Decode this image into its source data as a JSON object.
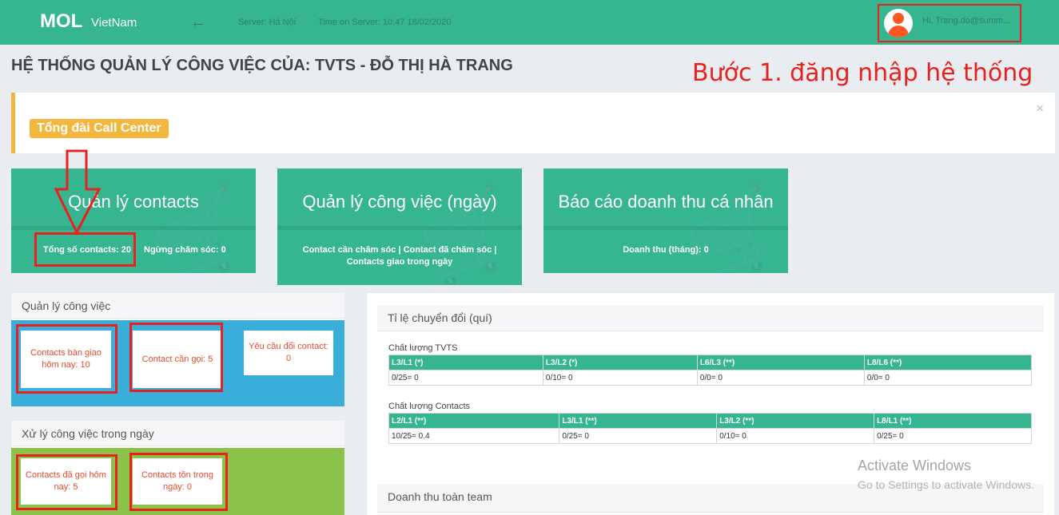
{
  "header": {
    "logo_main": "MOL",
    "logo_sub": "VietNam",
    "back_icon": "←",
    "server": "Server: Hà Nội",
    "time": "Time on Server: 10:47 18/02/2020",
    "user_greeting": "Hi, Trang.do@summ..."
  },
  "page_title": "HỆ THỐNG QUẢN LÝ CÔNG VIỆC CỦA: TVTS - ĐỖ THỊ HÀ TRANG",
  "annotation": "Bước 1. đăng nhập hệ thống",
  "callout": {
    "button": "Tổng đài Call Center",
    "close": "×"
  },
  "cards": {
    "contacts": {
      "title": "Quản lý contacts",
      "total": "Tổng số contacts: 20",
      "stopped": "Ngừng chăm sóc: 0"
    },
    "work": {
      "title": "Quản lý công việc (ngày)",
      "line1": "Contact cần chăm sóc |   Contact đã chăm sóc  |",
      "line2": "Contacts giao trong ngày"
    },
    "revenue": {
      "title": "Báo cáo doanh thu cá nhân",
      "line1": "Doanh thu (tháng): 0"
    }
  },
  "work_panel": {
    "title": "Quản lý công việc",
    "tile1": "Contacts bàn giao hôm nay: 10",
    "tile2": "Contact cần gọi: 5",
    "tile3": "Yêu cầu đổi contact: 0"
  },
  "daily_panel": {
    "title": "Xử lý công việc trong ngày",
    "tile1": "Contacts đã gọi hôm nay: 5",
    "tile2": "Contacts tồn trong ngày: 0"
  },
  "conversion": {
    "title": "Tỉ lệ chuyển đổi (quí)",
    "tvts_label": "Chất lượng TVTS",
    "tvts_headers": [
      "L3/L1 (*)",
      "L3/L2 (*)",
      "L6/L3 (**)",
      "L8/L6 (**)"
    ],
    "tvts_values": [
      "0/25= 0",
      "0/10= 0",
      "0/0= 0",
      "0/0= 0"
    ],
    "contacts_label": "Chất lượng Contacts",
    "contacts_headers": [
      "L2/L1 (**)",
      "L3/L1 (**)",
      "L3/L2 (**)",
      "L8/L1 (**)"
    ],
    "contacts_values": [
      "10/25= 0.4",
      "0/25= 0",
      "0/10= 0",
      "0/25= 0"
    ]
  },
  "team_revenue": {
    "title": "Doanh thu toàn team"
  },
  "watermark": {
    "line1": "Activate Windows",
    "line2": "Go to Settings to activate Windows."
  },
  "colors": {
    "primary": "#36b591",
    "accent": "#f4b73e",
    "highlight": "#e8211f",
    "blue": "#3aaedb",
    "green": "#8bc34a"
  }
}
